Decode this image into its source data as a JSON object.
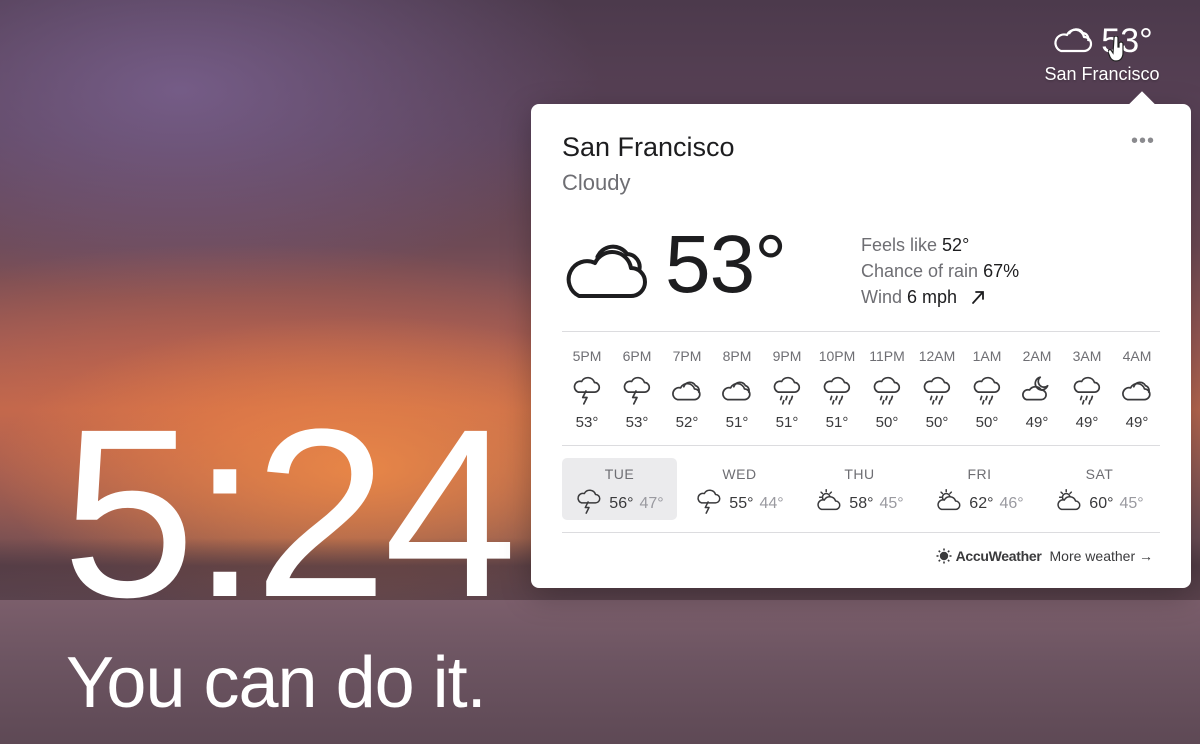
{
  "menubar": {
    "icon": "cloud-icon",
    "temperature": "53°",
    "city": "San Francisco"
  },
  "clock": {
    "time": "5:24"
  },
  "mantra": {
    "text": "You can do it."
  },
  "weather": {
    "city": "San Francisco",
    "condition": "Cloudy",
    "temperature": "53°",
    "more_label": "•••",
    "details": {
      "feels_like_label": "Feels like",
      "feels_like": "52°",
      "rain_label": "Chance of rain",
      "rain": "67%",
      "wind_label": "Wind",
      "wind": "6 mph",
      "wind_icon": "wind-direction-arrow-icon"
    },
    "hourly": [
      {
        "time": "5PM",
        "icon": "thunderstorm-icon",
        "temp": "53°"
      },
      {
        "time": "6PM",
        "icon": "thunderstorm-icon",
        "temp": "53°"
      },
      {
        "time": "7PM",
        "icon": "cloud-icon",
        "temp": "52°"
      },
      {
        "time": "8PM",
        "icon": "cloud-icon",
        "temp": "51°"
      },
      {
        "time": "9PM",
        "icon": "rain-icon",
        "temp": "51°"
      },
      {
        "time": "10PM",
        "icon": "rain-icon",
        "temp": "51°"
      },
      {
        "time": "11PM",
        "icon": "rain-icon",
        "temp": "50°"
      },
      {
        "time": "12AM",
        "icon": "rain-icon",
        "temp": "50°"
      },
      {
        "time": "1AM",
        "icon": "rain-icon",
        "temp": "50°"
      },
      {
        "time": "2AM",
        "icon": "moon-cloud-icon",
        "temp": "49°"
      },
      {
        "time": "3AM",
        "icon": "rain-icon",
        "temp": "49°"
      },
      {
        "time": "4AM",
        "icon": "cloud-icon",
        "temp": "49°"
      }
    ],
    "daily": [
      {
        "day": "TUE",
        "icon": "thunderstorm-icon",
        "high": "56°",
        "low": "47°",
        "selected": true
      },
      {
        "day": "WED",
        "icon": "thunderstorm-icon",
        "high": "55°",
        "low": "44°",
        "selected": false
      },
      {
        "day": "THU",
        "icon": "partly-sunny-icon",
        "high": "58°",
        "low": "45°",
        "selected": false
      },
      {
        "day": "FRI",
        "icon": "partly-sunny-icon",
        "high": "62°",
        "low": "46°",
        "selected": false
      },
      {
        "day": "SAT",
        "icon": "partly-sunny-icon",
        "high": "60°",
        "low": "45°",
        "selected": false
      }
    ],
    "footer": {
      "provider": "AccuWeather",
      "provider_icon": "accuweather-sun-icon",
      "more_weather": "More weather →"
    }
  }
}
